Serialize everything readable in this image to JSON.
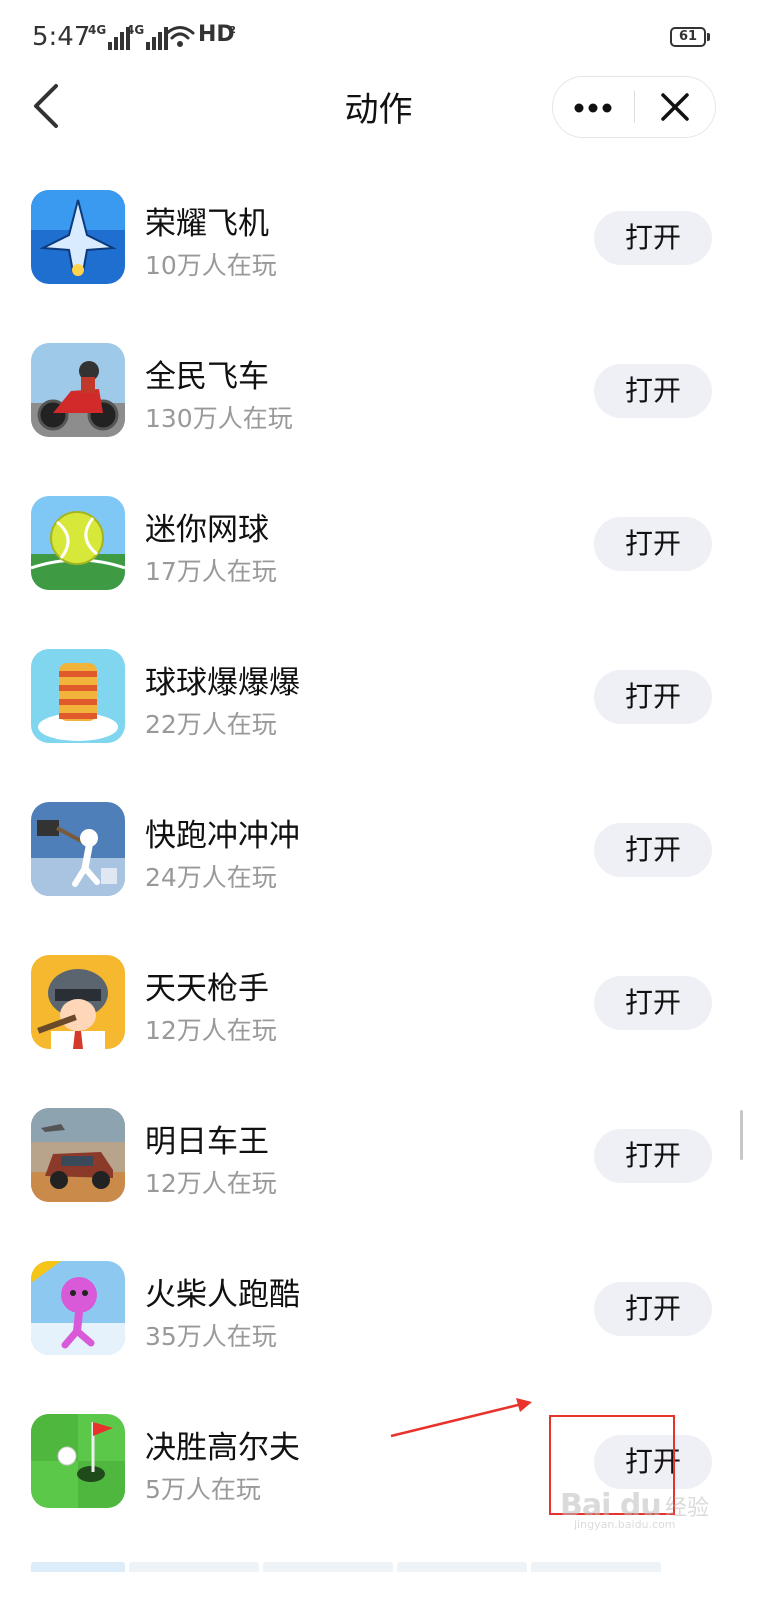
{
  "status_bar": {
    "time": "5:47",
    "network_1": "4G",
    "network_2": "4G",
    "hd_label": "HD",
    "hd_sub": "2",
    "battery": "61"
  },
  "nav": {
    "title": "动作",
    "back_icon": "chevron-left-icon",
    "more_icon": "more-dots-icon",
    "close_icon": "close-icon"
  },
  "games": [
    {
      "name": "荣耀飞机",
      "players": "10万人在玩",
      "button": "打开",
      "icon": "fighter-jet-icon"
    },
    {
      "name": "全民飞车",
      "players": "130万人在玩",
      "button": "打开",
      "icon": "motorcycle-icon"
    },
    {
      "name": "迷你网球",
      "players": "17万人在玩",
      "button": "打开",
      "icon": "tennis-ball-icon"
    },
    {
      "name": "球球爆爆爆",
      "players": "22万人在玩",
      "button": "打开",
      "icon": "helix-tower-icon"
    },
    {
      "name": "快跑冲冲冲",
      "players": "24万人在玩",
      "button": "打开",
      "icon": "runner-hammer-icon"
    },
    {
      "name": "天天枪手",
      "players": "12万人在玩",
      "button": "打开",
      "icon": "helmet-gunner-icon"
    },
    {
      "name": "明日车王",
      "players": "12万人在玩",
      "button": "打开",
      "icon": "offroad-car-icon"
    },
    {
      "name": "火柴人跑酷",
      "players": "35万人在玩",
      "button": "打开",
      "icon": "stickman-runner-icon"
    },
    {
      "name": "决胜高尔夫",
      "players": "5万人在玩",
      "button": "打开",
      "icon": "golf-hole-icon"
    }
  ],
  "colors": {
    "button_bg": "#eef0f6",
    "annotation": "#e8322c",
    "secondary_text": "#999999"
  },
  "watermark": {
    "logo": "Bai du",
    "cn": "经验",
    "url": "jingyan.baidu.com"
  }
}
